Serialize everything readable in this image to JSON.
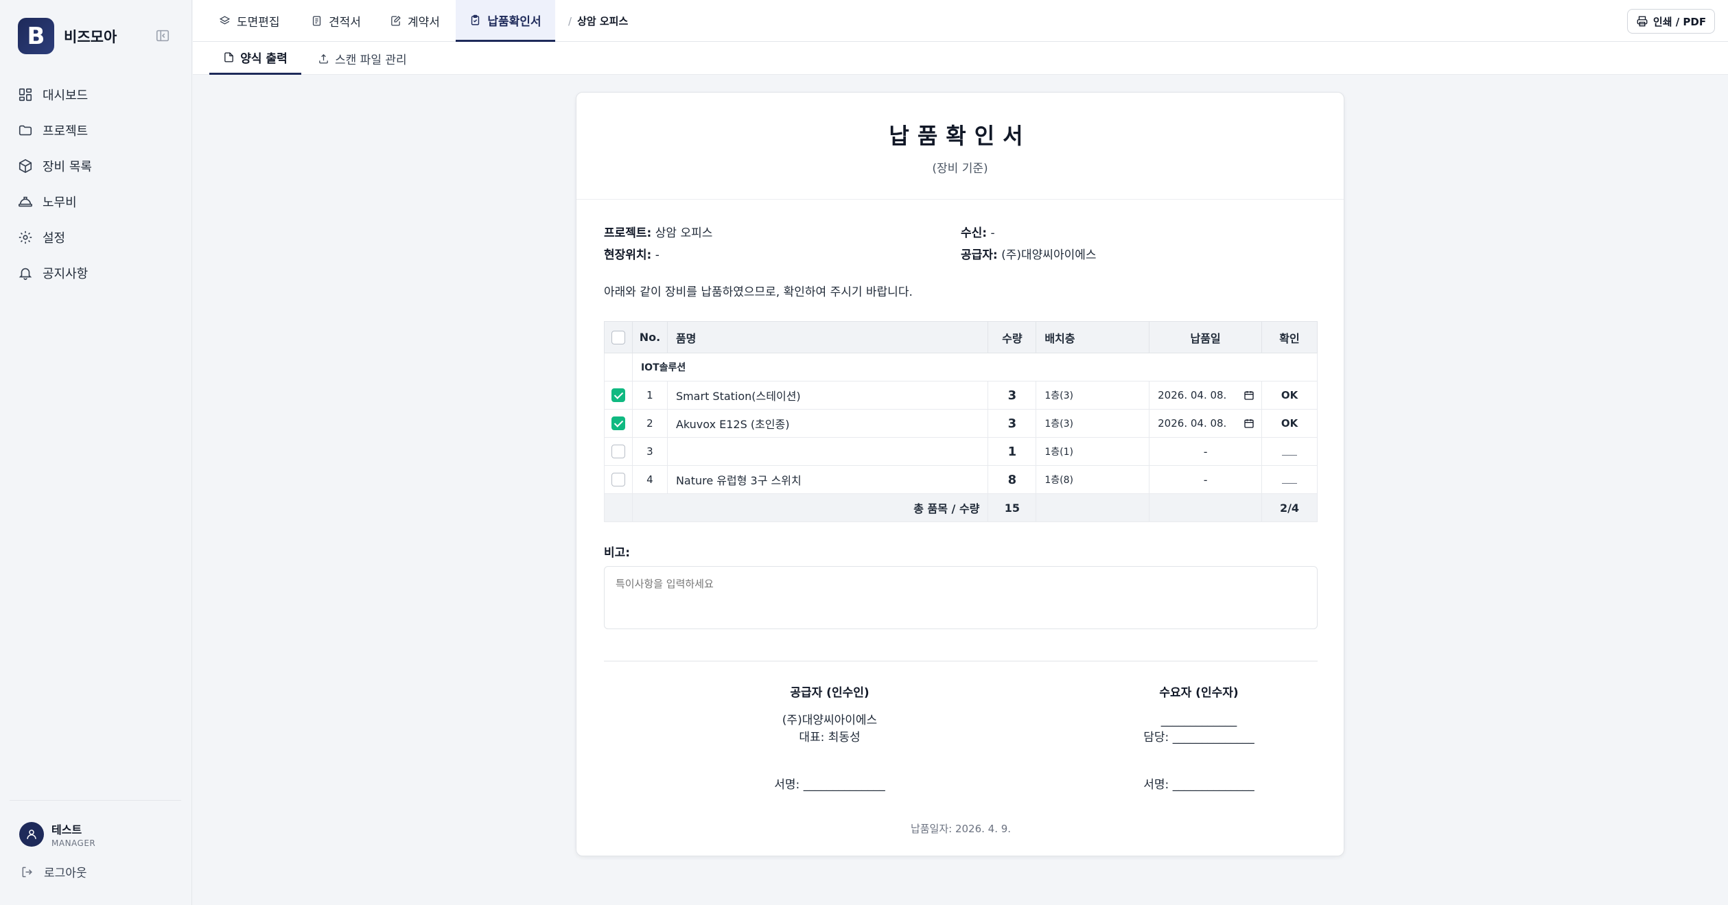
{
  "brand": {
    "logo_letter": "B",
    "name": "비즈모아"
  },
  "nav": [
    {
      "label": "대시보드",
      "icon": "dashboard-icon"
    },
    {
      "label": "프로젝트",
      "icon": "folder-icon"
    },
    {
      "label": "장비 목록",
      "icon": "box-icon"
    },
    {
      "label": "노무비",
      "icon": "hardhat-icon"
    },
    {
      "label": "설정",
      "icon": "gear-icon"
    },
    {
      "label": "공지사항",
      "icon": "bell-icon"
    }
  ],
  "user": {
    "name": "테스트",
    "role": "MANAGER"
  },
  "logout_label": "로그아웃",
  "tabs": [
    {
      "label": "도면편집"
    },
    {
      "label": "견적서"
    },
    {
      "label": "계약서"
    },
    {
      "label": "납품확인서"
    }
  ],
  "breadcrumb": {
    "separator": "/",
    "project": "상암 오피스"
  },
  "print_label": "인쇄 / PDF",
  "subtabs": [
    {
      "label": "양식 출력"
    },
    {
      "label": "스캔 파일 관리"
    }
  ],
  "doc": {
    "title": "납품확인서",
    "subtitle": "(장비 기준)",
    "meta": {
      "project_label": "프로젝트:",
      "project_value": "상암 오피스",
      "recipient_label": "수신:",
      "recipient_value": "-",
      "location_label": "현장위치:",
      "location_value": "-",
      "supplier_label": "공급자:",
      "supplier_value": "(주)대양씨아이에스"
    },
    "intro": "아래와 같이 장비를 납품하였으므로, 확인하여 주시기 바랍니다.",
    "table": {
      "headers": {
        "no": "No.",
        "name": "품명",
        "qty": "수량",
        "floor": "배치층",
        "date": "납품일",
        "confirm": "확인"
      },
      "group": "IOT솔루션",
      "rows": [
        {
          "checked": true,
          "no": "1",
          "name": "Smart Station(스테이션)",
          "qty": "3",
          "floor": "1층(3)",
          "date": "2026. 04. 08.",
          "confirm": "OK"
        },
        {
          "checked": true,
          "no": "2",
          "name": "Akuvox E12S (초인종)",
          "qty": "3",
          "floor": "1층(3)",
          "date": "2026. 04. 08.",
          "confirm": "OK"
        },
        {
          "checked": false,
          "no": "3",
          "name": "",
          "qty": "1",
          "floor": "1층(1)",
          "date": "-",
          "confirm": ""
        },
        {
          "checked": false,
          "no": "4",
          "name": "Nature 유럽형 3구 스위치",
          "qty": "8",
          "floor": "1층(8)",
          "date": "-",
          "confirm": ""
        }
      ],
      "total_label": "총 품목 / 수량",
      "total_qty": "15",
      "total_confirm": "2/4"
    },
    "remark_label": "비고:",
    "remark_placeholder": "특이사항을 입력하세요",
    "supplier_sign": {
      "title": "공급자 (인수인)",
      "company": "(주)대양씨아이에스",
      "rep": "대표: 최동성",
      "sign": "서명: ______________"
    },
    "buyer_sign": {
      "title": "수요자 (인수자)",
      "company": "_____________",
      "rep": "담당: ______________",
      "sign": "서명: ______________"
    },
    "delivery_date": "납품일자: 2026. 4. 9."
  },
  "colors": {
    "primary": "#1e2a5a",
    "ok": "#059669",
    "check": "#10b981"
  }
}
